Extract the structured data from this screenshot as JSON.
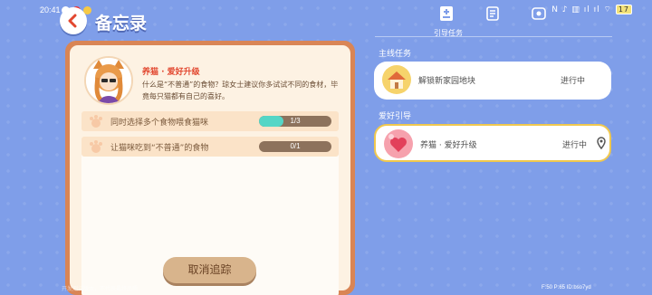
{
  "status_bar": {
    "time": "20:41",
    "right_text": "N ♪ ▥ ıl ıl ⌔",
    "battery": "17"
  },
  "header": {
    "title": "备忘录"
  },
  "tabs": {
    "active_label": "引导任务"
  },
  "quest_detail": {
    "title": "养猫 · 爱好升级",
    "description": "什么是“不普通”的食物？琼女士建议你多试试不同的食材，毕竟每只猫都有自己的喜好。",
    "tasks": [
      {
        "label": "同时选择多个食物喂食猫咪",
        "progress_text": "1/3",
        "progress": 0.333
      },
      {
        "label": "让猫咪吃到“不普通”的食物",
        "progress_text": "0/1",
        "progress": 0
      }
    ],
    "cancel_label": "取消追踪"
  },
  "sections": {
    "main_label": "主线任务",
    "hobby_label": "爱好引导"
  },
  "quest_list": {
    "main": {
      "name": "解锁新家园地块",
      "status": "进行中"
    },
    "hobby": {
      "name": "养猫 · 爱好升级",
      "status": "进行中"
    }
  },
  "footer": {
    "left": "开发测试版本，不代表最终品质",
    "right": "F:50  P:65  ID:bso7yd"
  },
  "colors": {
    "background": "#7f9ee9",
    "card_frame": "#d98555",
    "card_paper": "#fdf2e3",
    "progress_fill": "#55d6c6",
    "highlight_border": "#f0c84e"
  }
}
